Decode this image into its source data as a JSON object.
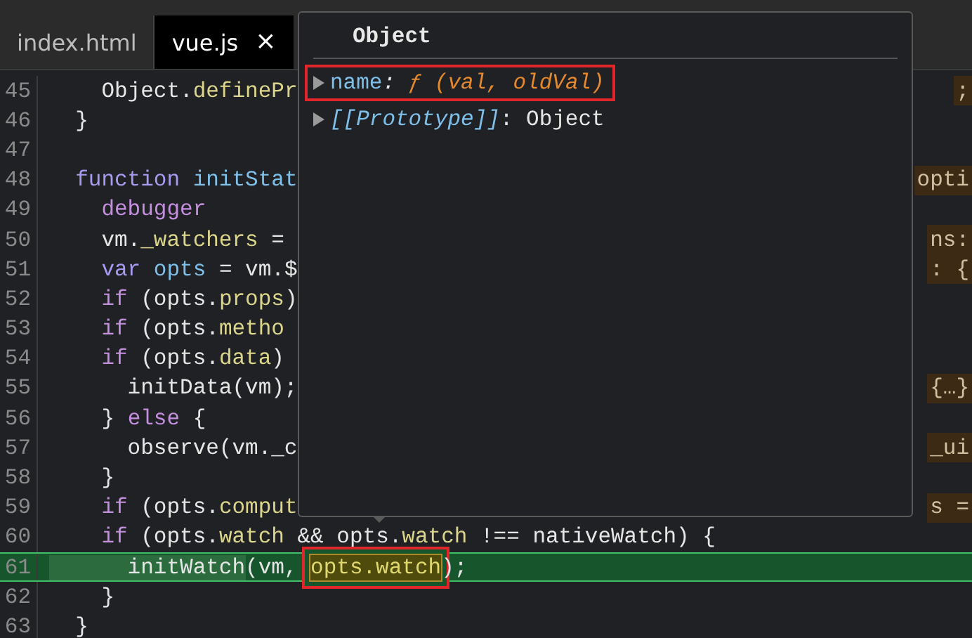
{
  "tabs": [
    {
      "label": "index.html",
      "selected": false
    },
    {
      "label": "vue.js",
      "selected": true,
      "close_glyph": "×"
    }
  ],
  "code_lines": [
    {
      "number": "45",
      "tokens": [
        {
          "kind": "plain",
          "text": "    Object."
        },
        {
          "kind": "prop",
          "text": "definePr"
        }
      ],
      "value_hint": ";",
      "current": false
    },
    {
      "number": "46",
      "tokens": [
        {
          "kind": "plain",
          "text": "  }"
        }
      ],
      "current": false
    },
    {
      "number": "47",
      "current": false
    },
    {
      "number": "48",
      "tokens": [
        {
          "kind": "keyword",
          "text": "  function "
        },
        {
          "kind": "name",
          "text": "initStat"
        }
      ],
      "value_hint": "opti",
      "current": false
    },
    {
      "number": "49",
      "tokens": [
        {
          "kind": "control",
          "text": "    debugger"
        }
      ],
      "current": false
    },
    {
      "number": "50",
      "tokens": [
        {
          "kind": "plain",
          "text": "    vm."
        },
        {
          "kind": "prop",
          "text": "_watchers"
        },
        {
          "kind": "plain",
          "text": " ="
        }
      ],
      "value_hint": "ns:",
      "current": false
    },
    {
      "number": "51",
      "tokens": [
        {
          "kind": "keyword",
          "text": "    var "
        },
        {
          "kind": "name",
          "text": "opts"
        },
        {
          "kind": "plain",
          "text": " = vm.$"
        }
      ],
      "value_hint": ": {",
      "current": false
    },
    {
      "number": "52",
      "tokens": [
        {
          "kind": "control",
          "text": "    if "
        },
        {
          "kind": "plain",
          "text": "(opts."
        },
        {
          "kind": "prop",
          "text": "props"
        },
        {
          "kind": "plain",
          "text": ")"
        }
      ],
      "current": false
    },
    {
      "number": "53",
      "tokens": [
        {
          "kind": "control",
          "text": "    if "
        },
        {
          "kind": "plain",
          "text": "(opts."
        },
        {
          "kind": "prop",
          "text": "metho"
        }
      ],
      "current": false
    },
    {
      "number": "54",
      "tokens": [
        {
          "kind": "control",
          "text": "    if "
        },
        {
          "kind": "plain",
          "text": "(opts."
        },
        {
          "kind": "prop",
          "text": "data"
        },
        {
          "kind": "plain",
          "text": ")"
        }
      ],
      "current": false
    },
    {
      "number": "55",
      "tokens": [
        {
          "kind": "plain",
          "text": "      initData(vm);"
        }
      ],
      "value_hint": "{…}",
      "current": false
    },
    {
      "number": "56",
      "tokens": [
        {
          "kind": "plain",
          "text": "    } "
        },
        {
          "kind": "control",
          "text": "else"
        },
        {
          "kind": "plain",
          "text": " {"
        }
      ],
      "current": false
    },
    {
      "number": "57",
      "tokens": [
        {
          "kind": "plain",
          "text": "      observe(vm._c"
        }
      ],
      "value_hint": "_ui",
      "current": false
    },
    {
      "number": "58",
      "tokens": [
        {
          "kind": "plain",
          "text": "    }"
        }
      ],
      "current": false
    },
    {
      "number": "59",
      "tokens": [
        {
          "kind": "control",
          "text": "    if "
        },
        {
          "kind": "plain",
          "text": "(opts."
        },
        {
          "kind": "prop",
          "text": "comput"
        }
      ],
      "value_hint": "s =",
      "current": false
    },
    {
      "number": "60",
      "tokens": [
        {
          "kind": "control",
          "text": "    if "
        },
        {
          "kind": "plain",
          "text": "(opts."
        },
        {
          "kind": "prop",
          "text": "watch"
        },
        {
          "kind": "plain",
          "text": " && opts."
        },
        {
          "kind": "prop",
          "text": "watch"
        },
        {
          "kind": "plain",
          "text": " !== nativeWatch) {"
        }
      ],
      "current": false
    },
    {
      "number": "61",
      "tokens": [
        {
          "kind": "call",
          "text": "      initWatch"
        },
        {
          "kind": "plain",
          "text": "(vm, "
        },
        {
          "kind": "hovered",
          "text": "opts.watch"
        },
        {
          "kind": "plain",
          "text": ");"
        }
      ],
      "current": true
    },
    {
      "number": "62",
      "tokens": [
        {
          "kind": "plain",
          "text": "    }"
        }
      ],
      "current": false
    },
    {
      "number": "63",
      "tokens": [
        {
          "kind": "plain",
          "text": "  }"
        }
      ],
      "current": false
    }
  ],
  "popover": {
    "title": "Object",
    "properties": [
      {
        "name": "name",
        "separator": ": ",
        "value": "ƒ (val, oldVal)",
        "kind": "function",
        "expanded": false,
        "annotated": true
      },
      {
        "name": "[[Prototype]]",
        "separator": ": ",
        "value": "Object",
        "kind": "internal",
        "expanded": false,
        "annotated": false
      }
    ]
  }
}
